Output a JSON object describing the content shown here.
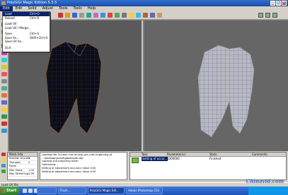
{
  "window": {
    "title": "PolyGiGi Magic Edition 5.3.5"
  },
  "menubar": {
    "items": [
      "Edit",
      "Edit",
      "Solid",
      "Adjust",
      "Tools",
      "Tools",
      "Help"
    ]
  },
  "file_menu": {
    "items": [
      {
        "label": "Load",
        "shortcut": "Ctrl+O"
      },
      {
        "label": "Reload",
        "shortcut": "Ctrl+R"
      },
      {
        "label": "Load UV",
        "shortcut": ""
      },
      {
        "label": "Load UV / Merge...",
        "shortcut": ""
      },
      {
        "label": "Save",
        "shortcut": "Ctrl+S"
      },
      {
        "label": "Save As...",
        "shortcut": "Shift+Ctrl+S"
      },
      {
        "label": "Save UV As...",
        "shortcut": ""
      },
      {
        "label": "Quit",
        "shortcut": ""
      }
    ]
  },
  "viewports": {
    "left_label": "",
    "right_label": ""
  },
  "mesh_info": {
    "title": "Mesh Info",
    "rows": [
      {
        "k": "Number of parts",
        "v": "1"
      },
      {
        "k": "Triangles",
        "v": "2"
      },
      {
        "k": "Faces",
        "v": ""
      },
      {
        "k": "Max Shear",
        "v": "1.00"
      },
      {
        "k": "Max Stretching",
        "v": "1.00"
      }
    ]
  },
  "log": {
    "lines": [
      "Loading file: D:\\user  rces  ds  pkg_pro_mat single.pkg_at",
      "...\\Desktop\\jacket\\galleon\\tib.obj",
      "Loading and preparing mesh",
      "Optimizing...",
      "Setting of adjustment accuracy  Value  0.00",
      "Setting of adjustment accuracy  Value  0.00"
    ]
  },
  "tasks": {
    "headers": [
      "Task",
      "Parameter(s)",
      "State",
      "Comments"
    ],
    "rows": [
      {
        "task": "Setting of accur...",
        "param": "1000000",
        "state": "Finished",
        "comment": ""
      }
    ]
  },
  "statusbar": {
    "text": "Load UV file"
  },
  "taskbar": {
    "start": "Start",
    "buttons": [
      "",
      "Flash...",
      "PolyGiGi Magic Edi...",
      "Adobe Photoshop CS3"
    ],
    "tray_time": ""
  },
  "watermark": {
    "text": "Chinavid.com"
  }
}
